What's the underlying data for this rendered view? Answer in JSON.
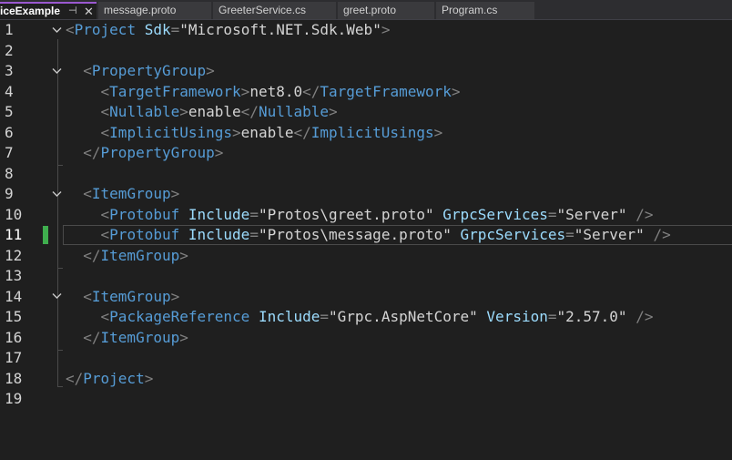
{
  "tabs": [
    {
      "label": "iceExample",
      "active": true,
      "pin_icon": "pin-icon",
      "close_icon": "close-icon"
    },
    {
      "label": "message.proto",
      "active": false
    },
    {
      "label": "GreeterService.cs",
      "active": false
    },
    {
      "label": "greet.proto",
      "active": false
    },
    {
      "label": "Program.cs",
      "active": false
    }
  ],
  "editor": {
    "current_line": 11,
    "colors": {
      "background": "#1f1f1f",
      "tag": "#569cd6",
      "attribute": "#9cdcfe",
      "punctuation": "#808080",
      "text": "#d4d4d4",
      "changed_marker": "#3fae4e"
    },
    "line_numbers": [
      "1",
      "2",
      "3",
      "4",
      "5",
      "6",
      "7",
      "8",
      "9",
      "10",
      "11",
      "12",
      "13",
      "14",
      "15",
      "16",
      "17",
      "18",
      "19"
    ],
    "lines": [
      {
        "indent": "",
        "tokens": [
          [
            "p",
            "<"
          ],
          [
            "t",
            "Project"
          ],
          [
            "x",
            " "
          ],
          [
            "a",
            "Sdk"
          ],
          [
            "p",
            "="
          ],
          [
            "s",
            "\"Microsoft.NET.Sdk.Web\""
          ],
          [
            "p",
            ">"
          ]
        ]
      },
      {
        "indent": "",
        "tokens": []
      },
      {
        "indent": "  ",
        "tokens": [
          [
            "p",
            "<"
          ],
          [
            "t",
            "PropertyGroup"
          ],
          [
            "p",
            ">"
          ]
        ]
      },
      {
        "indent": "    ",
        "tokens": [
          [
            "p",
            "<"
          ],
          [
            "t",
            "TargetFramework"
          ],
          [
            "p",
            ">"
          ],
          [
            "x",
            "net8.0"
          ],
          [
            "p",
            "</"
          ],
          [
            "t",
            "TargetFramework"
          ],
          [
            "p",
            ">"
          ]
        ]
      },
      {
        "indent": "    ",
        "tokens": [
          [
            "p",
            "<"
          ],
          [
            "t",
            "Nullable"
          ],
          [
            "p",
            ">"
          ],
          [
            "x",
            "enable"
          ],
          [
            "p",
            "</"
          ],
          [
            "t",
            "Nullable"
          ],
          [
            "p",
            ">"
          ]
        ]
      },
      {
        "indent": "    ",
        "tokens": [
          [
            "p",
            "<"
          ],
          [
            "t",
            "ImplicitUsings"
          ],
          [
            "p",
            ">"
          ],
          [
            "x",
            "enable"
          ],
          [
            "p",
            "</"
          ],
          [
            "t",
            "ImplicitUsings"
          ],
          [
            "p",
            ">"
          ]
        ]
      },
      {
        "indent": "  ",
        "tokens": [
          [
            "p",
            "</"
          ],
          [
            "t",
            "PropertyGroup"
          ],
          [
            "p",
            ">"
          ]
        ]
      },
      {
        "indent": "",
        "tokens": []
      },
      {
        "indent": "  ",
        "tokens": [
          [
            "p",
            "<"
          ],
          [
            "t",
            "ItemGroup"
          ],
          [
            "p",
            ">"
          ]
        ]
      },
      {
        "indent": "    ",
        "tokens": [
          [
            "p",
            "<"
          ],
          [
            "t",
            "Protobuf"
          ],
          [
            "x",
            " "
          ],
          [
            "a",
            "Include"
          ],
          [
            "p",
            "="
          ],
          [
            "s",
            "\"Protos\\greet.proto\""
          ],
          [
            "x",
            " "
          ],
          [
            "a",
            "GrpcServices"
          ],
          [
            "p",
            "="
          ],
          [
            "s",
            "\"Server\""
          ],
          [
            "x",
            " "
          ],
          [
            "p",
            "/>"
          ]
        ]
      },
      {
        "indent": "    ",
        "tokens": [
          [
            "p",
            "<"
          ],
          [
            "t",
            "Protobuf"
          ],
          [
            "x",
            " "
          ],
          [
            "a",
            "Include"
          ],
          [
            "p",
            "="
          ],
          [
            "s",
            "\"Protos\\message.proto\""
          ],
          [
            "x",
            " "
          ],
          [
            "a",
            "GrpcServices"
          ],
          [
            "p",
            "="
          ],
          [
            "s",
            "\"Server\""
          ],
          [
            "x",
            " "
          ],
          [
            "p",
            "/>"
          ]
        ]
      },
      {
        "indent": "  ",
        "tokens": [
          [
            "p",
            "</"
          ],
          [
            "t",
            "ItemGroup"
          ],
          [
            "p",
            ">"
          ]
        ]
      },
      {
        "indent": "",
        "tokens": []
      },
      {
        "indent": "  ",
        "tokens": [
          [
            "p",
            "<"
          ],
          [
            "t",
            "ItemGroup"
          ],
          [
            "p",
            ">"
          ]
        ]
      },
      {
        "indent": "    ",
        "tokens": [
          [
            "p",
            "<"
          ],
          [
            "t",
            "PackageReference"
          ],
          [
            "x",
            " "
          ],
          [
            "a",
            "Include"
          ],
          [
            "p",
            "="
          ],
          [
            "s",
            "\"Grpc.AspNetCore\""
          ],
          [
            "x",
            " "
          ],
          [
            "a",
            "Version"
          ],
          [
            "p",
            "="
          ],
          [
            "s",
            "\"2.57.0\""
          ],
          [
            "x",
            " "
          ],
          [
            "p",
            "/>"
          ]
        ]
      },
      {
        "indent": "  ",
        "tokens": [
          [
            "p",
            "</"
          ],
          [
            "t",
            "ItemGroup"
          ],
          [
            "p",
            ">"
          ]
        ]
      },
      {
        "indent": "",
        "tokens": []
      },
      {
        "indent": "",
        "tokens": [
          [
            "p",
            "</"
          ],
          [
            "t",
            "Project"
          ],
          [
            "p",
            ">"
          ]
        ]
      },
      {
        "indent": "",
        "tokens": []
      }
    ],
    "fold_icon": "chevron-down-icon",
    "fold_lines": [
      1,
      3,
      9,
      14
    ]
  }
}
